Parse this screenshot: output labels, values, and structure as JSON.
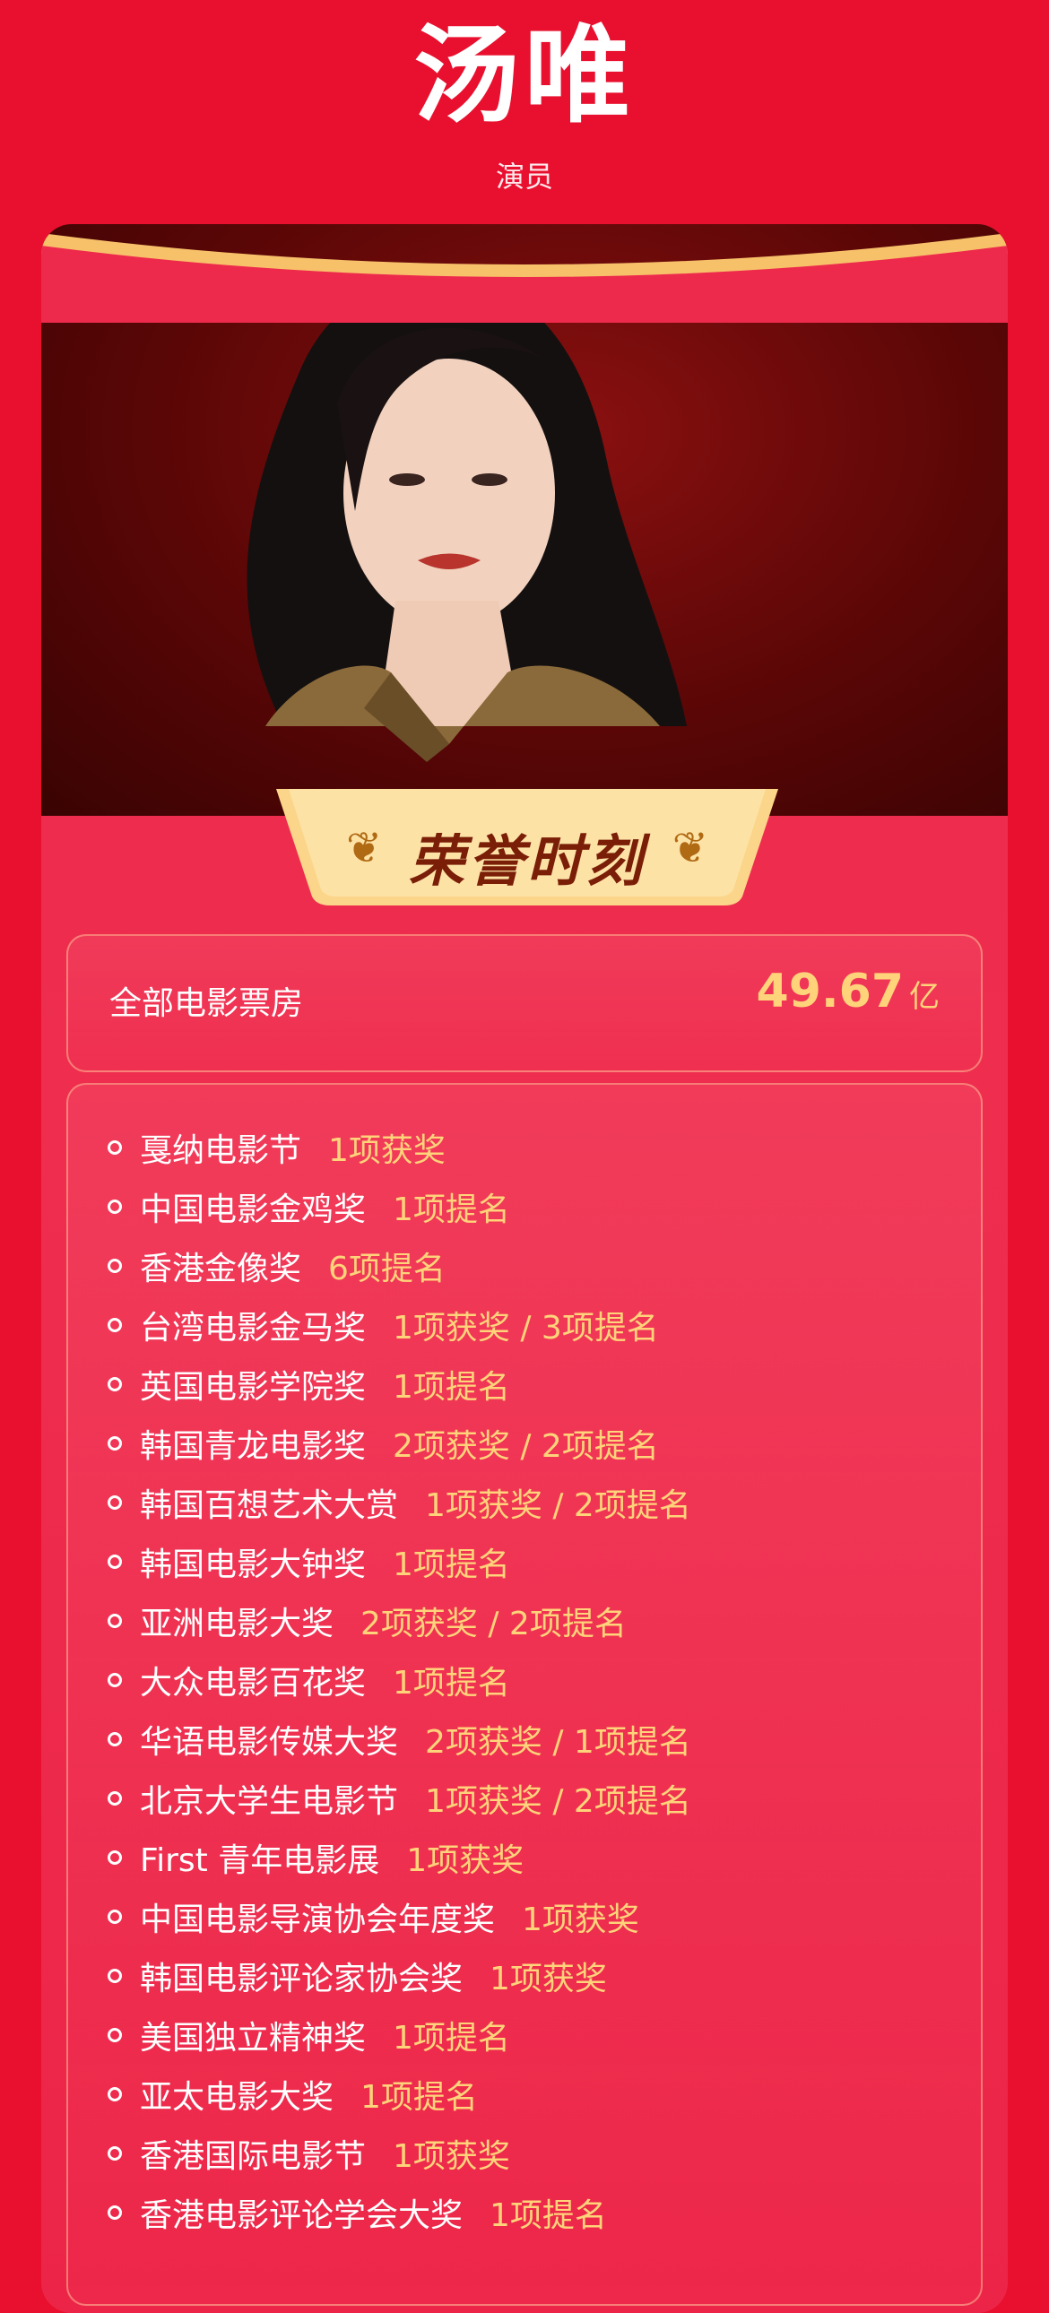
{
  "header": {
    "name": "汤唯",
    "role": "演员"
  },
  "banner": {
    "label": "荣誉时刻"
  },
  "box_office": {
    "label": "全部电影票房",
    "value": "49.67",
    "unit": "亿"
  },
  "awards": [
    {
      "name": "戛纳电影节",
      "result": "1项获奖"
    },
    {
      "name": "中国电影金鸡奖",
      "result": "1项提名"
    },
    {
      "name": "香港金像奖",
      "result": "6项提名"
    },
    {
      "name": "台湾电影金马奖",
      "result": "1项获奖 / 3项提名"
    },
    {
      "name": "英国电影学院奖",
      "result": "1项提名"
    },
    {
      "name": "韩国青龙电影奖",
      "result": "2项获奖 / 2项提名"
    },
    {
      "name": "韩国百想艺术大赏",
      "result": "1项获奖 / 2项提名"
    },
    {
      "name": "韩国电影大钟奖",
      "result": "1项提名"
    },
    {
      "name": "亚洲电影大奖",
      "result": "2项获奖 / 2项提名"
    },
    {
      "name": "大众电影百花奖",
      "result": "1项提名"
    },
    {
      "name": "华语电影传媒大奖",
      "result": "2项获奖 / 1项提名"
    },
    {
      "name": "北京大学生电影节",
      "result": "1项获奖 / 2项提名"
    },
    {
      "name": "First 青年电影展",
      "result": "1项获奖"
    },
    {
      "name": "中国电影导演协会年度奖",
      "result": "1项获奖"
    },
    {
      "name": "韩国电影评论家协会奖",
      "result": "1项获奖"
    },
    {
      "name": "美国独立精神奖",
      "result": "1项提名"
    },
    {
      "name": "亚太电影大奖",
      "result": "1项提名"
    },
    {
      "name": "香港国际电影节",
      "result": "1项获奖"
    },
    {
      "name": "香港电影评论学会大奖",
      "result": "1项提名"
    }
  ]
}
